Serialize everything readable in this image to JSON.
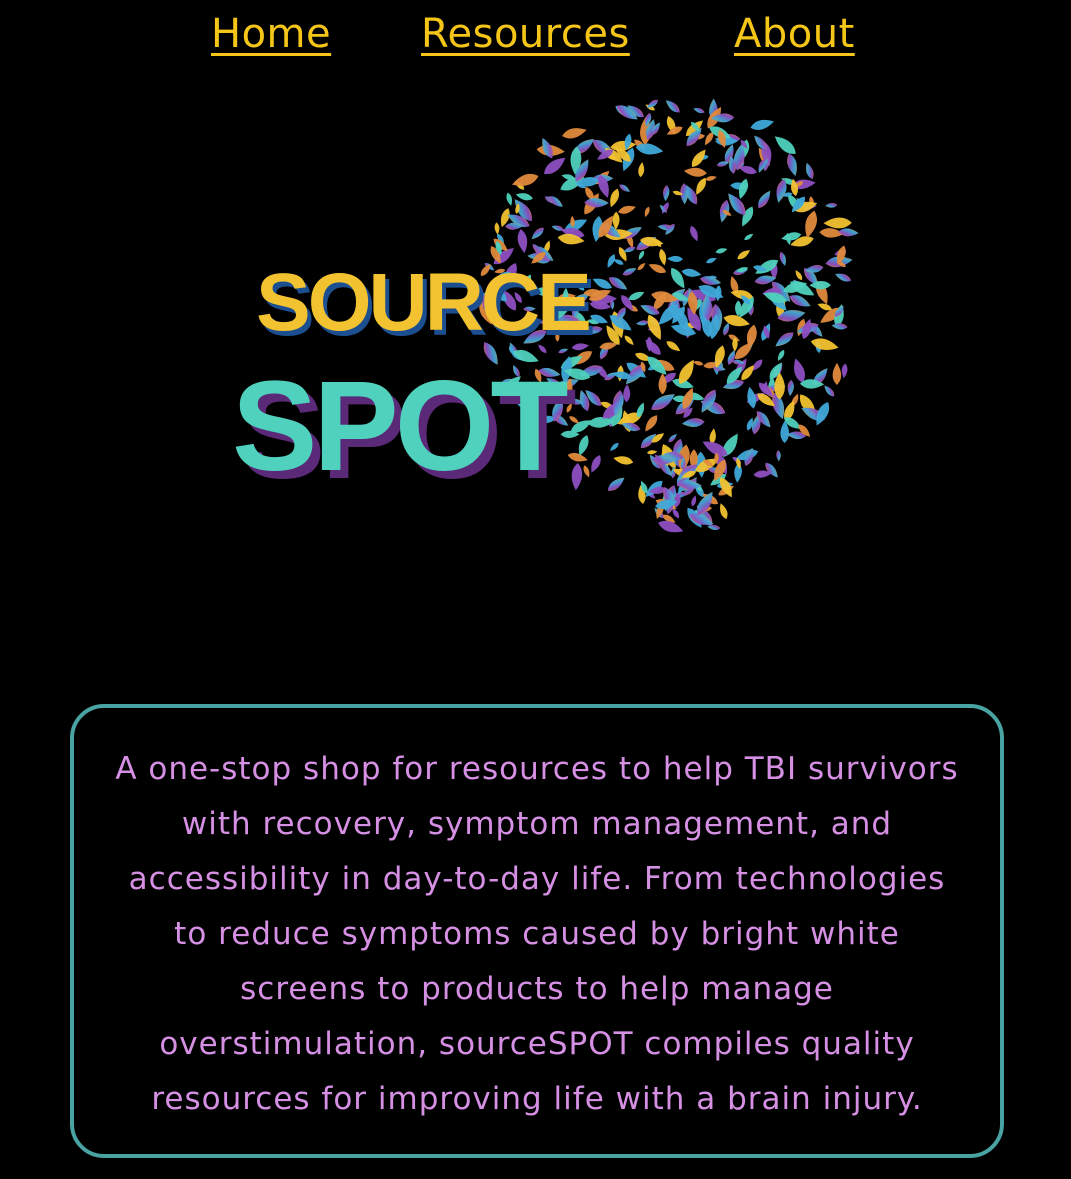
{
  "nav": {
    "items": [
      {
        "label": "Home"
      },
      {
        "label": "Resources"
      },
      {
        "label": "About"
      }
    ]
  },
  "logo": {
    "line1": "SOURCE",
    "line2": "SPOT",
    "colors": {
      "source": "#f2c230",
      "spot": "#4fd1bd",
      "shadow": "#5a2a78",
      "brain_palette": [
        "#e08a3c",
        "#3fa9d9",
        "#8e4fc2",
        "#4fd1bd",
        "#f2c230"
      ]
    }
  },
  "info": {
    "text": "A one-stop shop for resources to help TBI survivors with recovery, symptom management, and accessibility in day-to-day life. From technologies to reduce symptoms caused by bright white screens to products to help manage overstimulation, sourceSPOT compiles quality resources for improving life with a brain injury."
  },
  "colors": {
    "background": "#000000",
    "nav_link": "#f5c518",
    "info_text": "#d58fe3",
    "info_border": "#4aa3a3"
  }
}
